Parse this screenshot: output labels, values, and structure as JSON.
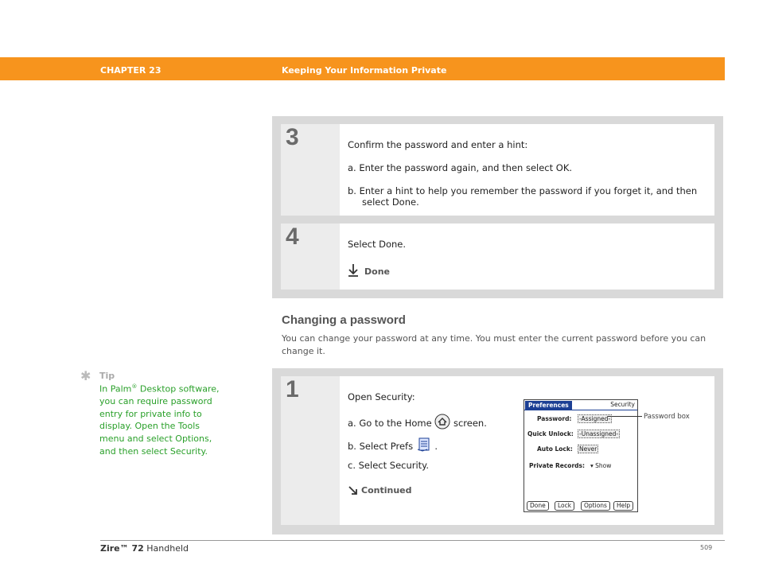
{
  "header": {
    "chapter": "CHAPTER 23",
    "title": "Keeping Your Information Private"
  },
  "steps_top": [
    {
      "number": "3",
      "intro": "Confirm the password and enter a hint:",
      "items": [
        "a.  Enter the password again, and then select OK.",
        "b.  Enter a hint to help you remember the password if you forget it, and then",
        "select Done."
      ]
    },
    {
      "number": "4",
      "intro": "Select Done.",
      "done_label": "Done"
    }
  ],
  "section": {
    "title": "Changing a password",
    "text": "You can change your password at any time. You must enter the current password before you can change it."
  },
  "tip": {
    "label": "Tip",
    "line1": "In Palm",
    "reg": "®",
    "line1b": " Desktop",
    "rest": "software, you can require password entry for private info to display. Open the Tools menu and select Options, and then select Security."
  },
  "step1": {
    "number": "1",
    "intro": "Open Security:",
    "a_prefix": "a.  Go to the Home",
    "a_suffix": "screen.",
    "b_prefix": "b.  Select Prefs",
    "b_suffix": ".",
    "c": "c.  Select Security.",
    "continued": "Continued"
  },
  "palm_screen": {
    "title": "Preferences",
    "right": "Security",
    "password_label": "Password:",
    "password_value": "-Assigned-",
    "quick_unlock_label": "Quick Unlock:",
    "quick_unlock_value": "-Unassigned-",
    "auto_lock_label": "Auto Lock:",
    "auto_lock_value": "Never",
    "private_label": "Private Records:",
    "private_value": "▾ Show",
    "buttons": [
      "Done",
      "Lock",
      "Options",
      "Help"
    ],
    "callout": "Password box"
  },
  "footer": {
    "product_bold": "Zire™ 72",
    "product_rest": " Handheld",
    "page": "509"
  }
}
